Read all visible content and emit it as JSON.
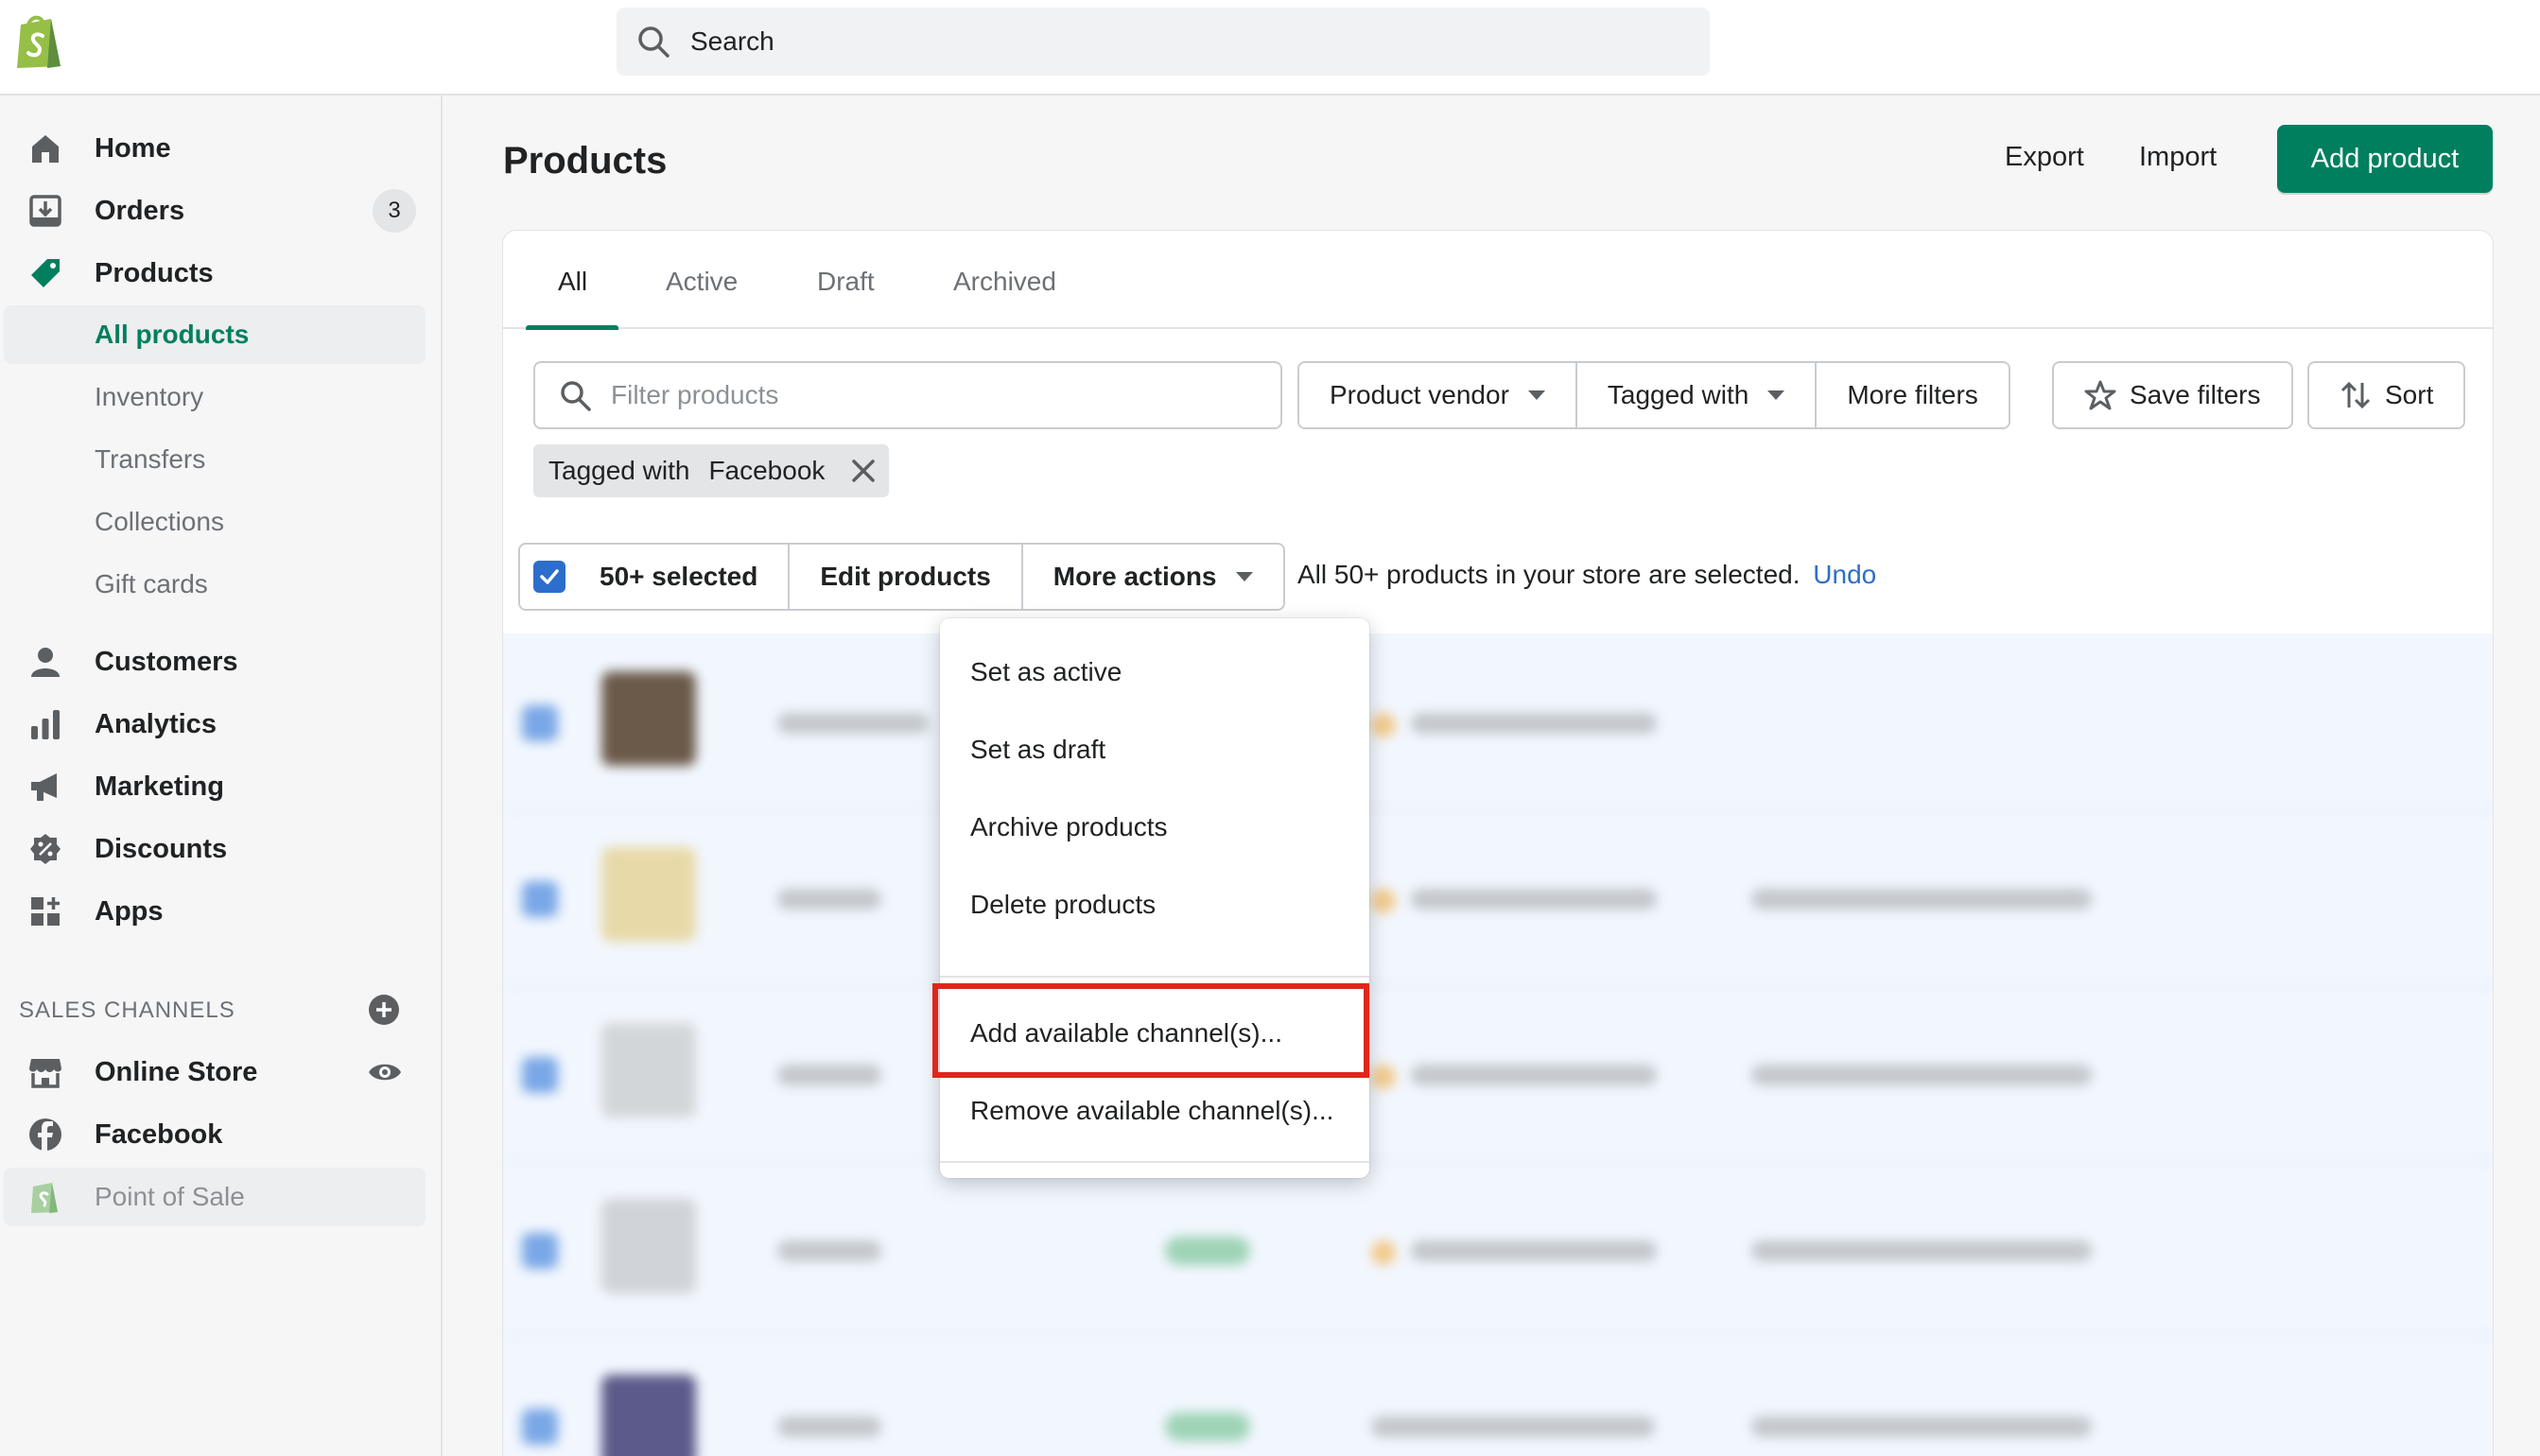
{
  "app": {
    "search_placeholder": "Search",
    "brand_color": "#95bf47",
    "accent_color": "#007f5f"
  },
  "sidebar": {
    "items": [
      {
        "label": "Home",
        "icon": "home-icon"
      },
      {
        "label": "Orders",
        "icon": "orders-icon",
        "badge": "3"
      },
      {
        "label": "Products",
        "icon": "tag-icon"
      },
      {
        "label": "Customers",
        "icon": "person-icon"
      },
      {
        "label": "Analytics",
        "icon": "bar-chart-icon"
      },
      {
        "label": "Marketing",
        "icon": "megaphone-icon"
      },
      {
        "label": "Discounts",
        "icon": "discount-icon"
      },
      {
        "label": "Apps",
        "icon": "apps-icon"
      }
    ],
    "product_subitems": [
      "All products",
      "Inventory",
      "Transfers",
      "Collections",
      "Gift cards"
    ],
    "sales_channels_title": "SALES CHANNELS",
    "channels": [
      {
        "label": "Online Store",
        "icon": "store-icon"
      },
      {
        "label": "Facebook",
        "icon": "facebook-icon"
      },
      {
        "label": "Point of Sale",
        "icon": "shopify-bag-icon"
      }
    ]
  },
  "header": {
    "title": "Products",
    "export_label": "Export",
    "import_label": "Import",
    "add_label": "Add product"
  },
  "tabs": [
    "All",
    "Active",
    "Draft",
    "Archived"
  ],
  "filters": {
    "placeholder": "Filter products",
    "vendor_label": "Product vendor",
    "tagged_label": "Tagged with",
    "more_label": "More filters",
    "save_label": "Save filters",
    "sort_label": "Sort",
    "chip_key": "Tagged with",
    "chip_value": "Facebook"
  },
  "bulk": {
    "selected_label": "50+ selected",
    "edit_label": "Edit products",
    "more_label": "More actions",
    "note": "All 50+ products in your store are selected.",
    "undo": "Undo"
  },
  "dropdown": {
    "items": [
      "Set as active",
      "Set as draft",
      "Archive products",
      "Delete products",
      "Add available channel(s)...",
      "Remove available channel(s)..."
    ]
  }
}
